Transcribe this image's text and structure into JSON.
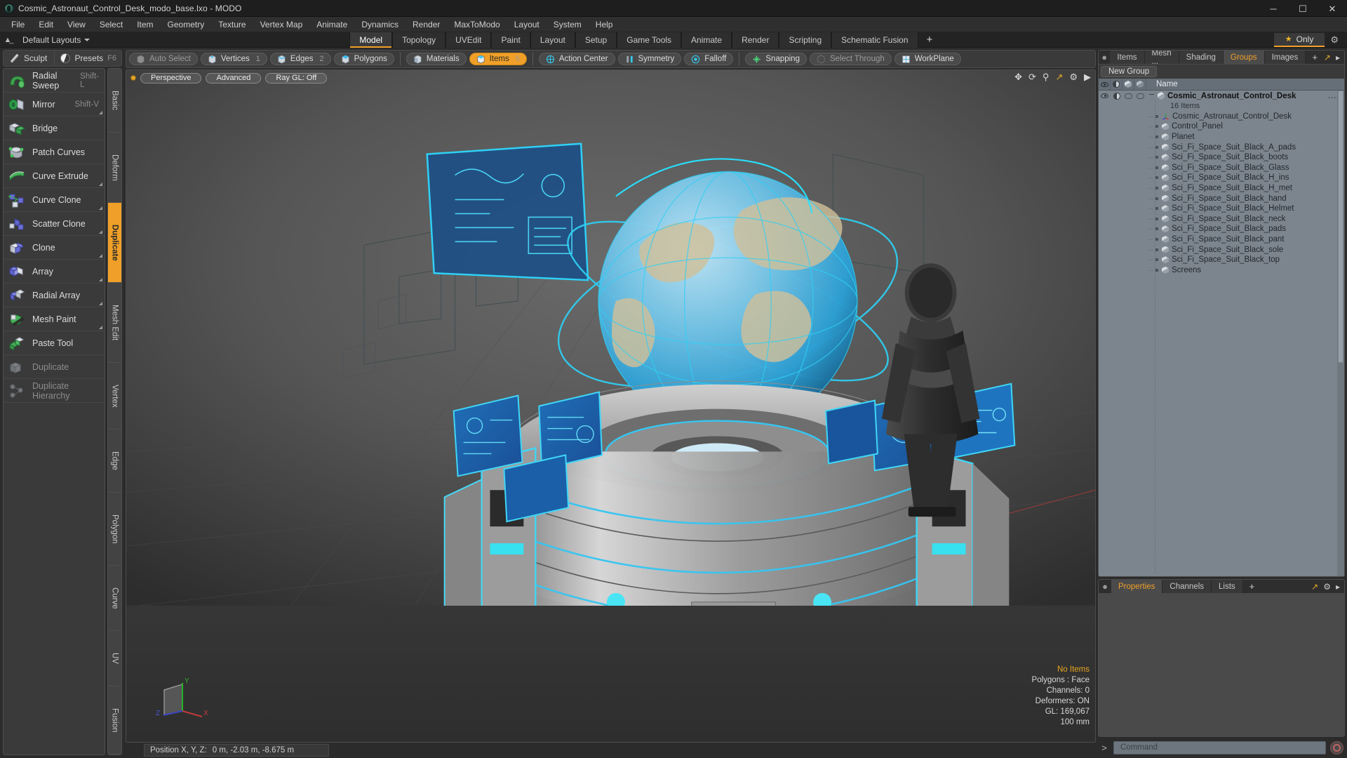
{
  "window": {
    "title": "Cosmic_Astronaut_Control_Desk_modo_base.lxo - MODO",
    "app_icon": "modo-logo-icon",
    "minimize": "─",
    "maximize": "☐",
    "close": "✕"
  },
  "menubar": {
    "items": [
      "File",
      "Edit",
      "View",
      "Select",
      "Item",
      "Geometry",
      "Texture",
      "Vertex Map",
      "Animate",
      "Dynamics",
      "Render",
      "MaxToModo",
      "Layout",
      "System",
      "Help"
    ]
  },
  "layoutbar": {
    "home_icon": "home-icon",
    "layout_preset": "Default Layouts",
    "mode_tabs": [
      {
        "label": "Model",
        "active": true
      },
      {
        "label": "Topology",
        "active": false
      },
      {
        "label": "UVEdit",
        "active": false
      },
      {
        "label": "Paint",
        "active": false
      },
      {
        "label": "Layout",
        "active": false
      },
      {
        "label": "Setup",
        "active": false
      },
      {
        "label": "Game Tools",
        "active": false
      },
      {
        "label": "Animate",
        "active": false
      },
      {
        "label": "Render",
        "active": false
      },
      {
        "label": "Scripting",
        "active": false
      },
      {
        "label": "Schematic Fusion",
        "active": false
      }
    ],
    "add_tab": "+",
    "only_label": "Only",
    "star_icon": "star-icon",
    "gear_icon": "gear-icon"
  },
  "left_panel": {
    "sculpt_label": "Sculpt",
    "presets_label": "Presets",
    "presets_hint": "F6",
    "tools": [
      {
        "label": "Radial Sweep",
        "kbd": "Shift-L",
        "disabled": false,
        "corner": false,
        "icon": "radial-sweep-icon"
      },
      {
        "label": "Mirror",
        "kbd": "Shift-V",
        "disabled": false,
        "corner": true,
        "icon": "mirror-icon"
      },
      {
        "label": "Bridge",
        "kbd": "",
        "disabled": false,
        "corner": false,
        "icon": "bridge-icon"
      },
      {
        "label": "Patch Curves",
        "kbd": "",
        "disabled": false,
        "corner": false,
        "icon": "patch-curves-icon"
      },
      {
        "label": "Curve Extrude",
        "kbd": "",
        "disabled": false,
        "corner": true,
        "icon": "curve-extrude-icon"
      },
      {
        "label": "Curve Clone",
        "kbd": "",
        "disabled": false,
        "corner": true,
        "icon": "curve-clone-icon"
      },
      {
        "label": "Scatter Clone",
        "kbd": "",
        "disabled": false,
        "corner": true,
        "icon": "scatter-clone-icon"
      },
      {
        "label": "Clone",
        "kbd": "",
        "disabled": false,
        "corner": true,
        "icon": "clone-icon"
      },
      {
        "label": "Array",
        "kbd": "",
        "disabled": false,
        "corner": true,
        "icon": "array-icon"
      },
      {
        "label": "Radial Array",
        "kbd": "",
        "disabled": false,
        "corner": true,
        "icon": "radial-array-icon"
      },
      {
        "label": "Mesh Paint",
        "kbd": "",
        "disabled": false,
        "corner": true,
        "icon": "mesh-paint-icon"
      },
      {
        "label": "Paste Tool",
        "kbd": "",
        "disabled": false,
        "corner": false,
        "icon": "paste-tool-icon"
      },
      {
        "label": "Duplicate",
        "kbd": "",
        "disabled": true,
        "corner": false,
        "icon": "duplicate-icon"
      },
      {
        "label": "Duplicate Hierarchy",
        "kbd": "",
        "disabled": true,
        "corner": false,
        "icon": "duplicate-hierarchy-icon"
      }
    ],
    "vtabs": [
      {
        "label": "Basic",
        "active": false
      },
      {
        "label": "Deform",
        "active": false
      },
      {
        "label": "Duplicate",
        "active": true
      },
      {
        "label": "Mesh Edit",
        "active": false
      },
      {
        "label": "Vertex",
        "active": false
      },
      {
        "label": "Edge",
        "active": false
      },
      {
        "label": "Polygon",
        "active": false
      },
      {
        "label": "Curve",
        "active": false
      },
      {
        "label": "UV",
        "active": false
      },
      {
        "label": "Fusion",
        "active": false
      }
    ]
  },
  "mode_toolbar": {
    "items": [
      {
        "label": "Auto Select",
        "num": "",
        "state": "off",
        "icon": "auto-select-icon"
      },
      {
        "label": "Vertices",
        "num": "1",
        "state": "normal",
        "icon": "vertices-icon"
      },
      {
        "label": "Edges",
        "num": "2",
        "state": "normal",
        "icon": "edges-icon"
      },
      {
        "label": "Polygons",
        "num": "",
        "state": "normal",
        "icon": "polygons-icon"
      },
      {
        "label": "Materials",
        "num": "",
        "state": "normal",
        "icon": "materials-icon"
      },
      {
        "label": "Items",
        "num": "5",
        "state": "selected",
        "icon": "items-icon"
      },
      {
        "label": "Action Center",
        "num": "",
        "state": "normal",
        "icon": "action-center-icon"
      },
      {
        "label": "Symmetry",
        "num": "",
        "state": "normal",
        "icon": "symmetry-icon"
      },
      {
        "label": "Falloff",
        "num": "",
        "state": "normal",
        "icon": "falloff-icon"
      },
      {
        "label": "Snapping",
        "num": "",
        "state": "normal",
        "icon": "snapping-icon"
      },
      {
        "label": "Select Through",
        "num": "",
        "state": "off",
        "icon": "select-through-icon"
      },
      {
        "label": "WorkPlane",
        "num": "",
        "state": "normal",
        "icon": "workplane-icon"
      }
    ]
  },
  "viewport": {
    "view_mode": "Perspective",
    "shading": "Advanced",
    "raygl": "Ray GL: Off",
    "tool_icons": [
      "move-icon",
      "rotate-icon",
      "zoom-icon",
      "fit-icon",
      "gear-icon",
      "play-icon"
    ],
    "stats": {
      "selection": "No Items",
      "polygons": "Polygons : Face",
      "channels": "Channels: 0",
      "deformers": "Deformers: ON",
      "gl": "GL: 169,067",
      "grid": "100 mm"
    },
    "axis_x": "X",
    "axis_y": "Y",
    "axis_z": "Z"
  },
  "status": {
    "position_label": "Position X, Y, Z:",
    "position_value": "0 m, -2.03 m, -8.675 m"
  },
  "right_panel": {
    "tabs": [
      {
        "label": "Items",
        "active": false
      },
      {
        "label": "Mesh ...",
        "active": false
      },
      {
        "label": "Shading",
        "active": false
      },
      {
        "label": "Groups",
        "active": true
      },
      {
        "label": "Images",
        "active": false
      }
    ],
    "add_tab": "+",
    "expand_icon": "expand-icon",
    "arrow_icon": "chevron-right-icon",
    "new_group_label": "New Group",
    "columns": [
      "eye-column",
      "shade-column",
      "lock-column",
      "render-column",
      "Name"
    ],
    "root": {
      "name": "Cosmic_Astronaut_Control_Desk",
      "subtitle": "16 Items",
      "overflow": "...."
    },
    "items": [
      {
        "name": "Cosmic_Astronaut_Control_Desk",
        "icon": "locator-icon"
      },
      {
        "name": "Control_Panel",
        "icon": "mesh-icon"
      },
      {
        "name": "Planet",
        "icon": "mesh-icon"
      },
      {
        "name": "Sci_Fi_Space_Suit_Black_A_pads",
        "icon": "mesh-icon"
      },
      {
        "name": "Sci_Fi_Space_Suit_Black_boots",
        "icon": "mesh-icon"
      },
      {
        "name": "Sci_Fi_Space_Suit_Black_Glass",
        "icon": "mesh-icon"
      },
      {
        "name": "Sci_Fi_Space_Suit_Black_H_ins",
        "icon": "mesh-icon"
      },
      {
        "name": "Sci_Fi_Space_Suit_Black_H_met",
        "icon": "mesh-icon"
      },
      {
        "name": "Sci_Fi_Space_Suit_Black_hand",
        "icon": "mesh-icon"
      },
      {
        "name": "Sci_Fi_Space_Suit_Black_Helmet",
        "icon": "mesh-icon"
      },
      {
        "name": "Sci_Fi_Space_Suit_Black_neck",
        "icon": "mesh-icon"
      },
      {
        "name": "Sci_Fi_Space_Suit_Black_pads",
        "icon": "mesh-icon"
      },
      {
        "name": "Sci_Fi_Space_Suit_Black_pant",
        "icon": "mesh-icon"
      },
      {
        "name": "Sci_Fi_Space_Suit_Black_sole",
        "icon": "mesh-icon"
      },
      {
        "name": "Sci_Fi_Space_Suit_Black_top",
        "icon": "mesh-icon"
      },
      {
        "name": "Screens",
        "icon": "mesh-icon"
      }
    ]
  },
  "bottom_panel": {
    "tabs": [
      {
        "label": "Properties",
        "active": true
      },
      {
        "label": "Channels",
        "active": false
      },
      {
        "label": "Lists",
        "active": false
      }
    ],
    "add_tab": "+",
    "command_placeholder": "Command",
    "command_prompt": ">",
    "record_icon": "record-icon"
  },
  "colors": {
    "accent": "#f0a028",
    "panel_bg": "#3a3a3a",
    "tree_bg": "#7c858e",
    "hologram_blue": "#29c3f0"
  }
}
